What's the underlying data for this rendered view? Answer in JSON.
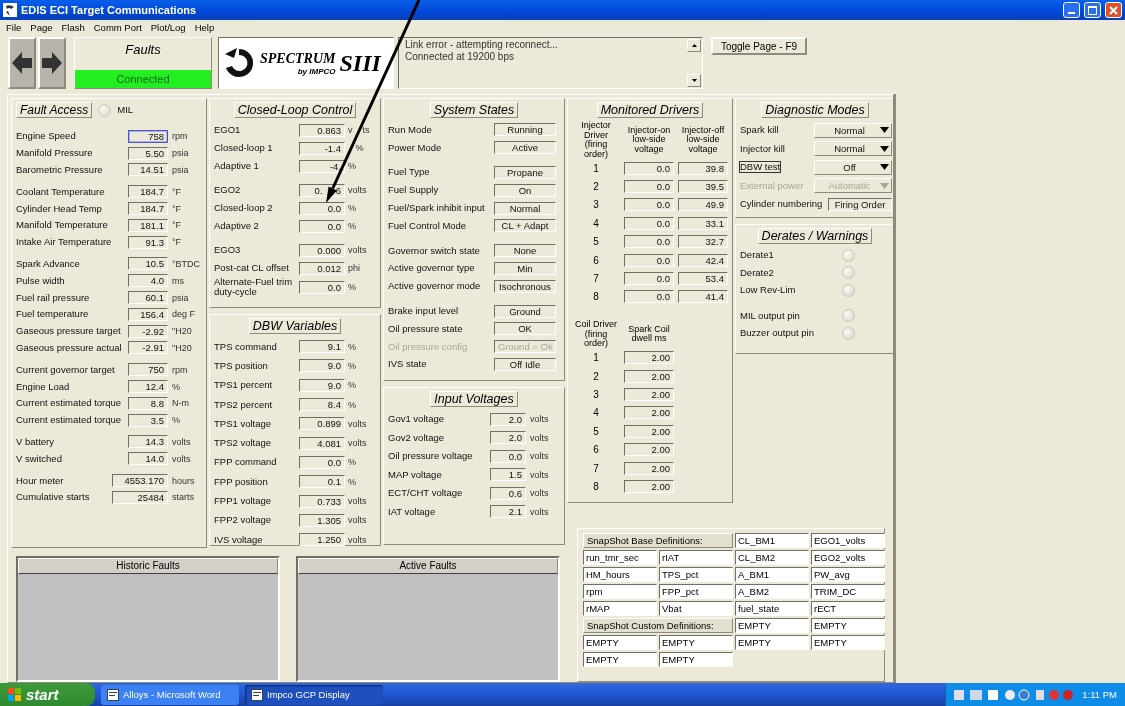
{
  "window": {
    "title": "EDIS ECI Target Communications"
  },
  "menu": [
    "File",
    "Page",
    "Flash",
    "Comm Port",
    "Plot/Log",
    "Help"
  ],
  "toolbar": {
    "fault_page": "Faults",
    "connection": {
      "label": "Connected",
      "connected": true
    },
    "logo": {
      "name": "SPECTRUM",
      "sub": "by IMPCO",
      "model": "SIII"
    },
    "messages": [
      "Link error - attempting reconnect...",
      "Connected at 19200 bps"
    ],
    "toggle_button": "Toggle Page - F9"
  },
  "fault_access": {
    "button": "Fault Access",
    "mil": {
      "label": "MIL",
      "on": false
    },
    "groups": [
      [
        {
          "label": "Engine Speed",
          "value": "758",
          "unit": "rpm",
          "kind": "reading",
          "focused": true
        },
        {
          "label": "Manifold Pressure",
          "value": "5.50",
          "unit": "psia",
          "kind": "reading",
          "focused": false
        },
        {
          "label": "Barometric Pressure",
          "value": "14.51",
          "unit": "psia",
          "kind": "reading",
          "focused": false
        }
      ],
      [
        {
          "label": "Coolant Temperature",
          "value": "184.7",
          "unit": "°F",
          "kind": "reading",
          "focused": false
        },
        {
          "label": "Cylinder Head Temp",
          "value": "184.7",
          "unit": "°F",
          "kind": "reading",
          "focused": false
        },
        {
          "label": "Manifold Temperature",
          "value": "181.1",
          "unit": "°F",
          "kind": "reading",
          "focused": false
        },
        {
          "label": "Intake Air Temperature",
          "value": "91.3",
          "unit": "°F",
          "kind": "reading",
          "focused": false
        }
      ],
      [
        {
          "label": "Spark Advance",
          "value": "10.5",
          "unit": "°BTDC",
          "kind": "reading",
          "focused": false
        },
        {
          "label": "Pulse width",
          "value": "4.0",
          "unit": "ms",
          "kind": "reading",
          "focused": false
        },
        {
          "label": "Fuel rail pressure",
          "value": "60.1",
          "unit": "psia",
          "kind": "reading",
          "focused": false
        },
        {
          "label": "Fuel temperature",
          "value": "156.4",
          "unit": "deg F",
          "kind": "reading",
          "focused": false
        },
        {
          "label": "Gaseous pressure target",
          "value": "-2.92",
          "unit": "\"H20",
          "kind": "reading",
          "focused": false
        },
        {
          "label": "Gaseous pressure actual",
          "value": "-2.91",
          "unit": "\"H20",
          "kind": "reading",
          "focused": false
        }
      ],
      [
        {
          "label": "Current governor target",
          "value": "750",
          "unit": "rpm",
          "kind": "reading",
          "focused": false
        },
        {
          "label": "Engine Load",
          "value": "12.4",
          "unit": "%",
          "kind": "reading",
          "focused": false
        },
        {
          "label": "Current estimated torque",
          "value": "8.8",
          "unit": "N-m",
          "kind": "reading",
          "focused": false
        },
        {
          "label": "Current estimated torque",
          "value": "3.5",
          "unit": "%",
          "kind": "reading",
          "focused": false
        }
      ],
      [
        {
          "label": "V battery",
          "value": "14.3",
          "unit": "volts",
          "kind": "reading",
          "focused": false
        },
        {
          "label": "V switched",
          "value": "14.0",
          "unit": "volts",
          "kind": "reading",
          "focused": false
        }
      ],
      [
        {
          "label": "Hour meter",
          "value": "4553.170",
          "unit": "hours",
          "kind": "counter",
          "focused": false
        },
        {
          "label": "Cumulative starts",
          "value": "25484",
          "unit": "starts",
          "kind": "counter",
          "focused": false
        }
      ]
    ]
  },
  "closed_loop": {
    "title": "Closed-Loop Control",
    "groups": [
      [
        {
          "label": "EGO1",
          "value": "0.863",
          "unit": "v    ts"
        },
        {
          "label": "Closed-loop 1",
          "value": "-1.4",
          "unit": "   %"
        },
        {
          "label": "Adaptive 1",
          "value": "-4.",
          "unit": "%"
        }
      ],
      [
        {
          "label": "EGO2",
          "value": "0.     6",
          "unit": "volts"
        },
        {
          "label": "Closed-loop 2",
          "value": "0.0",
          "unit": "%"
        },
        {
          "label": "Adaptive 2",
          "value": "0.0",
          "unit": "%"
        }
      ],
      [
        {
          "label": "EGO3",
          "value": "0.000",
          "unit": "volts"
        },
        {
          "label": "Post-cat CL offset",
          "value": "0.012",
          "unit": "phi"
        },
        {
          "label": "Alternate-Fuel trim duty-cycle",
          "value": "0.0",
          "unit": "%"
        }
      ]
    ]
  },
  "dbw": {
    "title": "DBW Variables",
    "rows": [
      {
        "label": "TPS command",
        "value": "9.1",
        "unit": "%"
      },
      {
        "label": "TPS position",
        "value": "9.0",
        "unit": "%"
      },
      {
        "label": "TPS1 percent",
        "value": "9.0",
        "unit": "%"
      },
      {
        "label": "TPS2 percent",
        "value": "8.4",
        "unit": "%"
      },
      {
        "label": "TPS1 voltage",
        "value": "0.899",
        "unit": "volts"
      },
      {
        "label": "TPS2 voltage",
        "value": "4.081",
        "unit": "volts"
      },
      {
        "label": "FPP command",
        "value": "0.0",
        "unit": "%"
      },
      {
        "label": "FPP position",
        "value": "0.1",
        "unit": "%"
      },
      {
        "label": "FPP1 voltage",
        "value": "0.733",
        "unit": "volts"
      },
      {
        "label": "FPP2 voltage",
        "value": "1.305",
        "unit": "volts"
      },
      {
        "label": "IVS voltage",
        "value": "1.250",
        "unit": "volts"
      }
    ]
  },
  "system_states": {
    "title": "System States",
    "groups": [
      [
        {
          "label": "Run Mode",
          "value": "Running",
          "disabled": false
        },
        {
          "label": "Power Mode",
          "value": "Active",
          "disabled": false
        }
      ],
      [
        {
          "label": "Fuel Type",
          "value": "Propane",
          "disabled": false
        },
        {
          "label": "Fuel Supply",
          "value": "On",
          "disabled": false
        },
        {
          "label": "Fuel/Spark inhibit input",
          "value": "Normal",
          "disabled": false
        },
        {
          "label": "Fuel Control Mode",
          "value": "CL + Adapt",
          "disabled": false
        }
      ],
      [
        {
          "label": "Governor switch state",
          "value": "None",
          "disabled": false
        },
        {
          "label": "Active governor type",
          "value": "Min",
          "disabled": false
        },
        {
          "label": "Active governor mode",
          "value": "Isochronous",
          "disabled": false
        }
      ],
      [
        {
          "label": "Brake input level",
          "value": "Ground",
          "disabled": false
        },
        {
          "label": "Oil pressure state",
          "value": "OK",
          "disabled": false
        },
        {
          "label": "Oil pressure config",
          "value": "Ground = Ok",
          "disabled": true
        },
        {
          "label": "IVS state",
          "value": "Off Idle",
          "disabled": false
        }
      ]
    ]
  },
  "input_voltages": {
    "title": "Input Voltages",
    "rows": [
      {
        "label": "Gov1 voltage",
        "value": "2.0",
        "unit": "volts"
      },
      {
        "label": "Gov2 voltage",
        "value": "2.0",
        "unit": "volts"
      },
      {
        "label": "Oil pressure voltage",
        "value": "0.0",
        "unit": "volts"
      },
      {
        "label": "MAP voltage",
        "value": "1.5",
        "unit": "volts"
      },
      {
        "label": "ECT/CHT voltage",
        "value": "0.6",
        "unit": "volts"
      },
      {
        "label": "IAT voltage",
        "value": "2.1",
        "unit": "volts"
      }
    ]
  },
  "monitored_drivers": {
    "title": "Monitored Drivers",
    "injector_headers": [
      "Injector Driver (firing order)",
      "Injector-on low-side voltage",
      "Injector-off low-side voltage"
    ],
    "injectors": [
      {
        "cylinder": "1",
        "on_voltage": "0.0",
        "off_voltage": "39.8"
      },
      {
        "cylinder": "2",
        "on_voltage": "0.0",
        "off_voltage": "39.5"
      },
      {
        "cylinder": "3",
        "on_voltage": "0.0",
        "off_voltage": "49.9"
      },
      {
        "cylinder": "4",
        "on_voltage": "0.0",
        "off_voltage": "33.1"
      },
      {
        "cylinder": "5",
        "on_voltage": "0.0",
        "off_voltage": "32.7"
      },
      {
        "cylinder": "6",
        "on_voltage": "0.0",
        "off_voltage": "42.4"
      },
      {
        "cylinder": "7",
        "on_voltage": "0.0",
        "off_voltage": "53.4"
      },
      {
        "cylinder": "8",
        "on_voltage": "0.0",
        "off_voltage": "41.4"
      }
    ],
    "coil_headers": [
      "Coil Driver (firing order)",
      "Spark Coil dwell ms"
    ],
    "coils": [
      {
        "cylinder": "1",
        "dwell": "2.00"
      },
      {
        "cylinder": "2",
        "dwell": "2.00"
      },
      {
        "cylinder": "3",
        "dwell": "2.00"
      },
      {
        "cylinder": "4",
        "dwell": "2.00"
      },
      {
        "cylinder": "5",
        "dwell": "2.00"
      },
      {
        "cylinder": "6",
        "dwell": "2.00"
      },
      {
        "cylinder": "7",
        "dwell": "2.00"
      },
      {
        "cylinder": "8",
        "dwell": "2.00"
      }
    ]
  },
  "diagnostic_modes": {
    "title": "Diagnostic Modes",
    "rows": [
      {
        "label": "Spark kill",
        "value": "Normal",
        "kind": "dropdown",
        "disabled": false,
        "focused": false
      },
      {
        "label": "Injector kill",
        "value": "Normal",
        "kind": "dropdown",
        "disabled": false,
        "focused": false
      },
      {
        "label": "DBW test",
        "value": "Off",
        "kind": "dropdown",
        "disabled": false,
        "focused": true
      },
      {
        "label": "External power",
        "value": "Automatic",
        "kind": "dropdown",
        "disabled": true,
        "focused": false
      },
      {
        "label": "Cylinder numbering",
        "value": "Firing Order",
        "kind": "field",
        "disabled": false,
        "focused": false
      }
    ]
  },
  "derates": {
    "title": "Derates / Warnings",
    "groups": [
      [
        {
          "label": "Derate1",
          "on": false
        },
        {
          "label": "Derate2",
          "on": false
        },
        {
          "label": "Low Rev-Lim",
          "on": false
        }
      ],
      [
        {
          "label": "MIL output pin",
          "on": false
        },
        {
          "label": "Buzzer output pin",
          "on": false
        }
      ]
    ]
  },
  "fault_lists": [
    {
      "title": "Historic Faults"
    },
    {
      "title": "Active Faults"
    }
  ],
  "snapshot": {
    "sections": [
      {
        "title": "SnapShot Base Definitions:",
        "cells": [
          "CL_BM1",
          "EGO1_volts",
          "run_tmr_sec",
          "rIAT",
          "CL_BM2",
          "EGO2_volts",
          "HM_hours",
          "TPS_pct",
          "A_BM1",
          "PW_avg",
          "rpm",
          "FPP_pct",
          "A_BM2",
          "TRIM_DC",
          "rMAP",
          "Vbat",
          "fuel_state",
          "rECT"
        ]
      },
      {
        "title": "SnapShot Custom Definitions:",
        "cells": [
          "EMPTY",
          "EMPTY",
          "EMPTY",
          "EMPTY",
          "EMPTY",
          "EMPTY",
          "EMPTY",
          "EMPTY"
        ]
      }
    ]
  },
  "taskbar": {
    "start": "start",
    "tasks": [
      {
        "label": "Alloys - Microsoft Word",
        "selected": false
      },
      {
        "label": "Impco GCP Display",
        "selected": true
      }
    ],
    "clock": "1:11 PM"
  }
}
